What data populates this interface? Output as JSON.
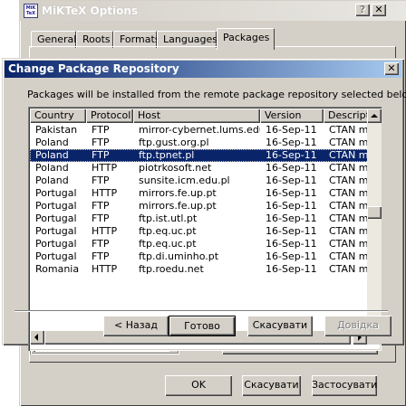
{
  "options_window": {
    "title": "MiKTeX Options",
    "icon_text": "MiK TeX",
    "tabs": [
      "General",
      "Roots",
      "Formats",
      "Languages",
      "Packages"
    ],
    "active_tab": "Packages",
    "buttons": {
      "ok": "OK",
      "cancel": "Скасувати",
      "apply": "Застосувати"
    }
  },
  "dialog": {
    "title": "Change Package Repository",
    "message": "Packages will be installed from the remote package repository selected below.",
    "columns": [
      "Country",
      "Protocol",
      "Host",
      "Version",
      "Description"
    ],
    "rows": [
      {
        "country": "Pakistan",
        "protocol": "FTP",
        "host": "mirror-cybernet.lums.edu....",
        "version": "16-Sep-11",
        "description": "CTAN m"
      },
      {
        "country": "Poland",
        "protocol": "FTP",
        "host": "ftp.gust.org.pl",
        "version": "16-Sep-11",
        "description": "CTAN m"
      },
      {
        "country": "Poland",
        "protocol": "FTP",
        "host": "ftp.tpnet.pl",
        "version": "16-Sep-11",
        "description": "CTAN m",
        "selected": true
      },
      {
        "country": "Poland",
        "protocol": "HTTP",
        "host": "piotrkosoft.net",
        "version": "16-Sep-11",
        "description": "CTAN m"
      },
      {
        "country": "Poland",
        "protocol": "FTP",
        "host": "sunsite.icm.edu.pl",
        "version": "16-Sep-11",
        "description": "CTAN m"
      },
      {
        "country": "Portugal",
        "protocol": "HTTP",
        "host": "mirrors.fe.up.pt",
        "version": "16-Sep-11",
        "description": "CTAN m"
      },
      {
        "country": "Portugal",
        "protocol": "FTP",
        "host": "mirrors.fe.up.pt",
        "version": "16-Sep-11",
        "description": "CTAN m"
      },
      {
        "country": "Portugal",
        "protocol": "FTP",
        "host": "ftp.ist.utl.pt",
        "version": "16-Sep-11",
        "description": "CTAN m"
      },
      {
        "country": "Portugal",
        "protocol": "HTTP",
        "host": "ftp.eq.uc.pt",
        "version": "16-Sep-11",
        "description": "CTAN m"
      },
      {
        "country": "Portugal",
        "protocol": "FTP",
        "host": "ftp.eq.uc.pt",
        "version": "16-Sep-11",
        "description": "CTAN m"
      },
      {
        "country": "Portugal",
        "protocol": "FTP",
        "host": "ftp.di.uminho.pt",
        "version": "16-Sep-11",
        "description": "CTAN m"
      },
      {
        "country": "Romania",
        "protocol": "HTTP",
        "host": "ftp.roedu.net",
        "version": "16-Sep-11",
        "description": "CTAN m"
      }
    ],
    "buttons": {
      "back": "< Назад",
      "finish": "Готово",
      "cancel": "Скасувати",
      "help": "Довідка"
    }
  },
  "colors": {
    "titlebar_active": "#0a246a",
    "selection": "#0a246a",
    "face": "#d4d0c8"
  }
}
